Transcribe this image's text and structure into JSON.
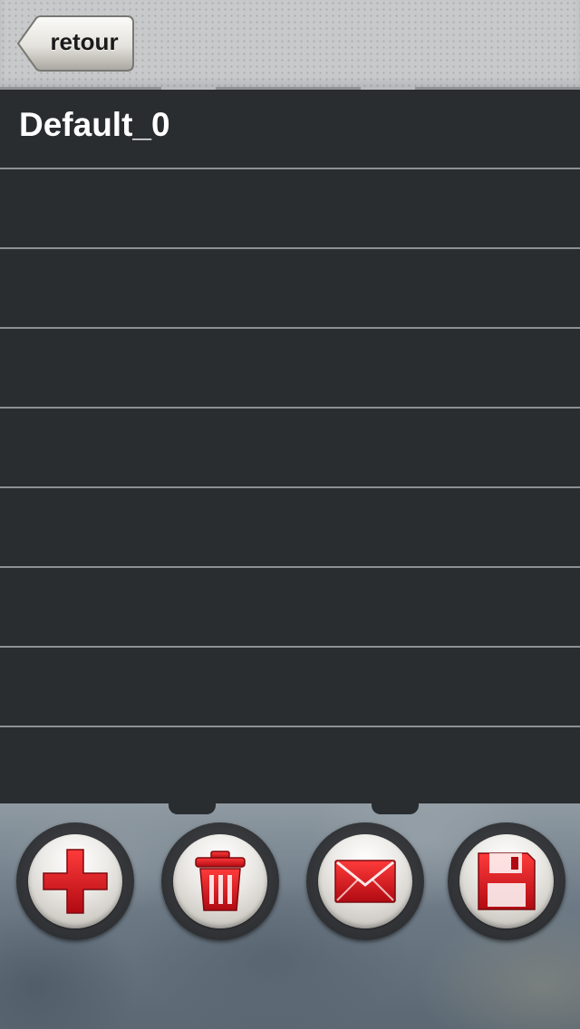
{
  "nav": {
    "back_label": "retour"
  },
  "list": {
    "items": [
      {
        "label": "Default_0"
      },
      {
        "label": ""
      },
      {
        "label": ""
      },
      {
        "label": ""
      },
      {
        "label": ""
      },
      {
        "label": ""
      },
      {
        "label": ""
      },
      {
        "label": ""
      },
      {
        "label": ""
      }
    ]
  },
  "toolbar": {
    "buttons": [
      {
        "icon": "plus-icon"
      },
      {
        "icon": "trash-icon"
      },
      {
        "icon": "mail-icon"
      },
      {
        "icon": "save-icon"
      }
    ],
    "icon_color": "#d8121c"
  },
  "colors": {
    "background": "#2a2d30",
    "topbar": "#c8c9cb",
    "separator": "#8e9194",
    "row_text": "#ffffff"
  }
}
